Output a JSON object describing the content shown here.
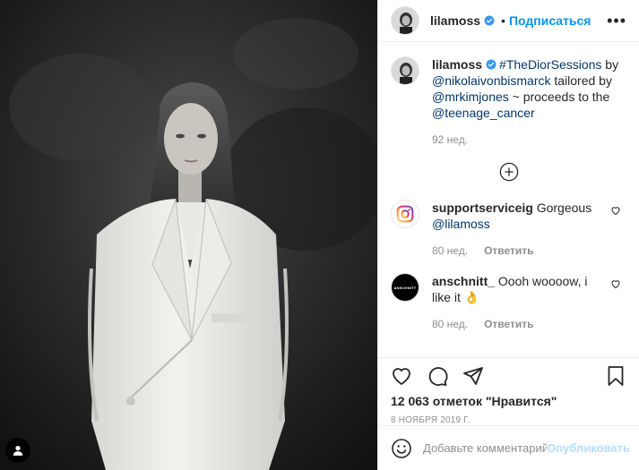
{
  "header": {
    "username": "lilamoss",
    "separator": "•",
    "follow_label": "Подписаться",
    "more_label": "•••"
  },
  "caption": {
    "username": "lilamoss",
    "hashtag": "#TheDiorSessions",
    "text_by": " by ",
    "mention_1": "@nikolaivonbismarck",
    "text_tailored": " tailored by ",
    "mention_2": "@mrkimjones",
    "text_proceeds": " ~ proceeds to the ",
    "mention_3": "@teenage_cancer",
    "age": "92 нед."
  },
  "comments": [
    {
      "username": "supportserviceig",
      "text": " Gorgeous ",
      "mention": "@lilamoss",
      "age": "80 нед.",
      "reply_label": "Ответить"
    },
    {
      "username": "anschnitt_",
      "text": " Oooh woooow, i like it ",
      "emoji": "👌",
      "age": "80 нед.",
      "reply_label": "Ответить",
      "avatar_text": "ANSCHNITT"
    }
  ],
  "likes_text": "12 063 отметок \"Нравится\"",
  "date_text": "8 ноября 2019 г.",
  "composer": {
    "placeholder": "Добавьте комментарий...",
    "publish_label": "Опубликовать"
  },
  "colors": {
    "accent": "#0095f6",
    "link": "#00376b",
    "muted": "#8e8e8e",
    "publish_disabled": "#b2dffc"
  },
  "icons": [
    "verified-badge-icon",
    "more-options-icon",
    "add-circle-icon",
    "heart-icon",
    "comment-icon",
    "share-icon",
    "bookmark-icon",
    "emoji-icon",
    "user-tag-icon"
  ]
}
